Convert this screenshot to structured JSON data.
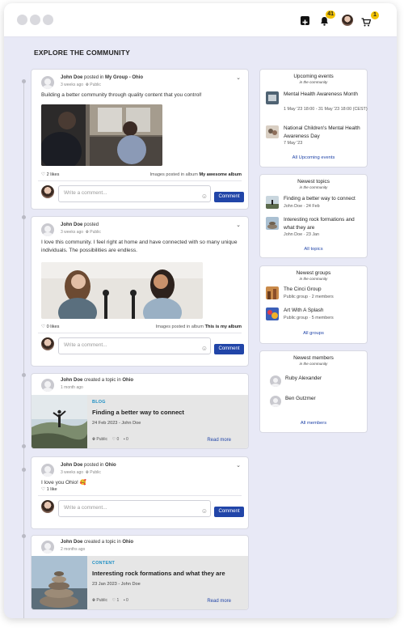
{
  "header": {
    "notifications_count": "41",
    "cart_count": "1",
    "icons": [
      "plus-icon",
      "bell-icon",
      "avatar",
      "cart-icon"
    ]
  },
  "page": {
    "title": "EXPLORE THE COMMUNITY"
  },
  "posts": [
    {
      "author": "John Doe",
      "action": "posted in",
      "target": "My Group - Ohio",
      "time": "3 weeks ago",
      "visibility": "Public",
      "text": "Building a better community through quality content that you control!",
      "likes": "2 likes",
      "album_prefix": "Images posted in album",
      "album_name": "My awesome album",
      "comment_placeholder": "Write a comment...",
      "comment_button": "Comment"
    },
    {
      "author": "John Doe",
      "action": "posted",
      "time": "3 weeks ago",
      "visibility": "Public",
      "text": "I love this community. I feel right at home and have connected with so many unique individuals. The possibilities are endless.",
      "likes": "0 likes",
      "album_prefix": "Images posted in album",
      "album_name": "This is my album",
      "comment_placeholder": "Write a comment...",
      "comment_button": "Comment"
    },
    {
      "author": "John Doe",
      "action": "posted in",
      "target": "Ohio",
      "time": "3 weeks ago",
      "visibility": "Public",
      "text": "I love you Ohio! 🥰",
      "likes": "1 like",
      "comment_placeholder": "Write a comment...",
      "comment_button": "Comment"
    }
  ],
  "topics": [
    {
      "author": "John Doe",
      "action": "created a topic in",
      "target": "Ohio",
      "time": "1 month ago",
      "kind": "BLOG",
      "title": "Finding a better way to connect",
      "date": "24 Feb 2023 - John Doe",
      "visibility": "Public",
      "likes": "0",
      "comments": "0",
      "read_more": "Read more"
    },
    {
      "author": "John Doe",
      "action": "created a topic in",
      "target": "Ohio",
      "time": "2 months ago",
      "kind": "CONTENT",
      "title": "Interesting rock formations and what they are",
      "date": "23 Jan 2023 - John Doe",
      "visibility": "Public",
      "likes": "1",
      "comments": "0",
      "read_more": "Read more"
    }
  ],
  "sidebar": {
    "events": {
      "title": "Upcoming events",
      "subtitle": "in the community",
      "items": [
        {
          "title": "Mental Health Awareness Month",
          "sub": "1 May '23 18:00 - 31 May '23 18:00 (CEST)"
        },
        {
          "title": "National Children's Mental Health Awareness Day",
          "sub": "7 May '23"
        }
      ],
      "link": "All Upcoming events"
    },
    "topics": {
      "title": "Newest topics",
      "subtitle": "in the community",
      "items": [
        {
          "title": "Finding a better way to connect",
          "sub": "John Doe · 24 Feb"
        },
        {
          "title": "Interesting rock formations and what they are",
          "sub": "John Doe · 23 Jan"
        }
      ],
      "link": "All topics"
    },
    "groups": {
      "title": "Newest groups",
      "subtitle": "in the community",
      "items": [
        {
          "title": "The Cinci Group",
          "sub": "Public group · 2 members"
        },
        {
          "title": "Art With A Splash",
          "sub": "Public group · 5 members"
        }
      ],
      "link": "All groups"
    },
    "members": {
      "title": "Newest members",
      "subtitle": "in the community",
      "items": [
        {
          "name": "Ruby Alexander"
        },
        {
          "name": "Ben Gutzmer"
        }
      ],
      "link": "All members"
    }
  }
}
